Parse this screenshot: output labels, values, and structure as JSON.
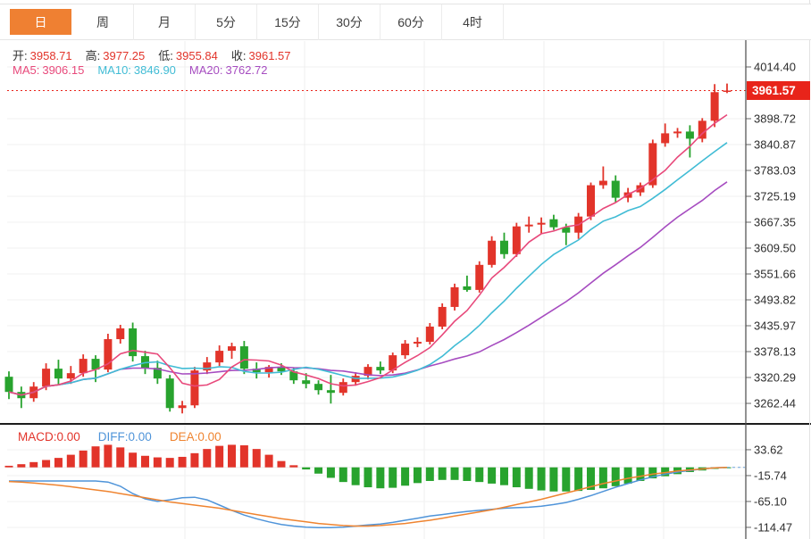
{
  "tabs": {
    "items": [
      {
        "label": "日",
        "active": true
      },
      {
        "label": "周",
        "active": false
      },
      {
        "label": "月",
        "active": false
      },
      {
        "label": "5分",
        "active": false
      },
      {
        "label": "15分",
        "active": false
      },
      {
        "label": "30分",
        "active": false
      },
      {
        "label": "60分",
        "active": false
      },
      {
        "label": "4时",
        "active": false
      }
    ]
  },
  "legend": {
    "ohlc": [
      {
        "label": "开:",
        "value": "3958.71"
      },
      {
        "label": "高:",
        "value": "3977.25"
      },
      {
        "label": "低:",
        "value": "3955.84"
      },
      {
        "label": "收:",
        "value": "3961.57"
      }
    ],
    "ma": [
      {
        "label": "MA5:",
        "value": "3906.15"
      },
      {
        "label": "MA10:",
        "value": "3846.90"
      },
      {
        "label": "MA20:",
        "value": "3762.72"
      }
    ]
  },
  "macd_legend": [
    {
      "label": "MACD:",
      "value": "0.00"
    },
    {
      "label": "DIFF:",
      "value": "0.00"
    },
    {
      "label": "DEA:",
      "value": "0.00"
    }
  ],
  "price_axis": {
    "ticks": [
      4014.4,
      3898.72,
      3840.87,
      3783.03,
      3725.19,
      3667.35,
      3609.5,
      3551.66,
      3493.82,
      3435.97,
      3378.13,
      3320.29,
      3262.44
    ],
    "current_price": 3961.57
  },
  "macd_axis": {
    "ticks": [
      33.62,
      -15.74,
      -65.1,
      -114.47
    ]
  },
  "colors": {
    "up": "#e2342a",
    "down": "#28a32e",
    "ma5": "#e8497b",
    "ma10": "#41bcd5",
    "ma20": "#a64cc0",
    "diff": "#4f94d9",
    "dea": "#ef8430",
    "badge": "#e8241a",
    "tab_accent": "#ef8032"
  },
  "chart_data": {
    "type": "candlestick",
    "title": "",
    "xlabel": "",
    "ylabel": "",
    "legend_position": "top-left",
    "grid": true,
    "price_range": [
      3262.44,
      4014.4
    ],
    "macd_range": [
      -114.47,
      33.62
    ],
    "current_price": 3961.57,
    "ma_periods": [
      5,
      10,
      20
    ],
    "candles": [
      [
        3322,
        3334,
        3272,
        3288
      ],
      [
        3288,
        3300,
        3252,
        3274
      ],
      [
        3274,
        3310,
        3266,
        3300
      ],
      [
        3300,
        3352,
        3292,
        3340
      ],
      [
        3340,
        3360,
        3304,
        3318
      ],
      [
        3318,
        3346,
        3306,
        3330
      ],
      [
        3330,
        3372,
        3322,
        3362
      ],
      [
        3362,
        3370,
        3310,
        3338
      ],
      [
        3338,
        3418,
        3332,
        3406
      ],
      [
        3406,
        3438,
        3396,
        3430
      ],
      [
        3430,
        3443,
        3356,
        3368
      ],
      [
        3368,
        3380,
        3328,
        3342
      ],
      [
        3342,
        3358,
        3306,
        3318
      ],
      [
        3318,
        3326,
        3244,
        3252
      ],
      [
        3252,
        3268,
        3240,
        3258
      ],
      [
        3258,
        3344,
        3252,
        3336
      ],
      [
        3336,
        3366,
        3328,
        3354
      ],
      [
        3354,
        3392,
        3346,
        3380
      ],
      [
        3380,
        3398,
        3362,
        3390
      ],
      [
        3390,
        3402,
        3328,
        3340
      ],
      [
        3340,
        3354,
        3318,
        3332
      ],
      [
        3332,
        3348,
        3320,
        3344
      ],
      [
        3344,
        3352,
        3326,
        3334
      ],
      [
        3334,
        3342,
        3306,
        3314
      ],
      [
        3314,
        3330,
        3296,
        3306
      ],
      [
        3306,
        3314,
        3282,
        3292
      ],
      [
        3292,
        3326,
        3262,
        3286
      ],
      [
        3286,
        3318,
        3280,
        3310
      ],
      [
        3310,
        3332,
        3302,
        3324
      ],
      [
        3324,
        3350,
        3316,
        3344
      ],
      [
        3344,
        3356,
        3328,
        3336
      ],
      [
        3336,
        3376,
        3330,
        3370
      ],
      [
        3370,
        3404,
        3362,
        3396
      ],
      [
        3396,
        3410,
        3388,
        3400
      ],
      [
        3400,
        3442,
        3394,
        3434
      ],
      [
        3434,
        3486,
        3428,
        3478
      ],
      [
        3478,
        3530,
        3470,
        3522
      ],
      [
        3524,
        3548,
        3512,
        3516
      ],
      [
        3516,
        3580,
        3510,
        3572
      ],
      [
        3572,
        3636,
        3566,
        3626
      ],
      [
        3626,
        3644,
        3586,
        3596
      ],
      [
        3596,
        3666,
        3590,
        3658
      ],
      [
        3658,
        3680,
        3644,
        3662
      ],
      [
        3662,
        3678,
        3642,
        3666
      ],
      [
        3674,
        3684,
        3650,
        3656
      ],
      [
        3656,
        3664,
        3616,
        3644
      ],
      [
        3644,
        3688,
        3630,
        3680
      ],
      [
        3680,
        3756,
        3672,
        3750
      ],
      [
        3750,
        3792,
        3742,
        3760
      ],
      [
        3760,
        3772,
        3712,
        3722
      ],
      [
        3722,
        3744,
        3712,
        3734
      ],
      [
        3734,
        3756,
        3726,
        3750
      ],
      [
        3750,
        3852,
        3744,
        3844
      ],
      [
        3844,
        3888,
        3836,
        3866
      ],
      [
        3866,
        3878,
        3856,
        3870
      ],
      [
        3870,
        3884,
        3812,
        3854
      ],
      [
        3854,
        3900,
        3846,
        3894
      ],
      [
        3894,
        3976,
        3880,
        3958
      ],
      [
        3958.71,
        3977.25,
        3955.84,
        3961.57
      ]
    ],
    "macd": {
      "histogram": [
        3,
        6,
        10,
        14,
        18,
        24,
        32,
        40,
        43,
        38,
        28,
        22,
        19,
        18,
        20,
        27,
        35,
        41,
        43,
        42,
        35,
        24,
        12,
        4,
        -4,
        -12,
        -20,
        -28,
        -34,
        -38,
        -40,
        -39,
        -35,
        -30,
        -26,
        -24,
        -24,
        -26,
        -28,
        -31,
        -34,
        -38,
        -41,
        -44,
        -46,
        -46,
        -45,
        -43,
        -40,
        -36,
        -31,
        -26,
        -21,
        -17,
        -13,
        -9,
        -6,
        -3,
        -1
      ],
      "diff": [
        -26,
        -26,
        -26,
        -26,
        -26,
        -26,
        -26,
        -26,
        -28,
        -36,
        -50,
        -60,
        -65,
        -62,
        -58,
        -57,
        -62,
        -72,
        -82,
        -91,
        -98,
        -104,
        -109,
        -112,
        -114,
        -115,
        -115,
        -114,
        -112,
        -110,
        -108,
        -105,
        -101,
        -97,
        -93,
        -90,
        -87,
        -84,
        -82,
        -80,
        -78,
        -77,
        -76,
        -74,
        -71,
        -67,
        -61,
        -54,
        -46,
        -38,
        -31,
        -24,
        -18,
        -13,
        -9,
        -6,
        -3,
        -1,
        0
      ],
      "dea": [
        -27,
        -28,
        -30,
        -32,
        -34,
        -37,
        -40,
        -43,
        -46,
        -50,
        -54,
        -58,
        -62,
        -66,
        -69,
        -72,
        -75,
        -78,
        -82,
        -86,
        -90,
        -94,
        -98,
        -101,
        -104,
        -107,
        -109,
        -111,
        -112,
        -112,
        -111,
        -109,
        -107,
        -104,
        -101,
        -97,
        -93,
        -89,
        -85,
        -81,
        -76,
        -71,
        -66,
        -61,
        -55,
        -49,
        -43,
        -37,
        -31,
        -26,
        -21,
        -17,
        -13,
        -10,
        -7,
        -5,
        -3,
        -1,
        0
      ]
    }
  }
}
